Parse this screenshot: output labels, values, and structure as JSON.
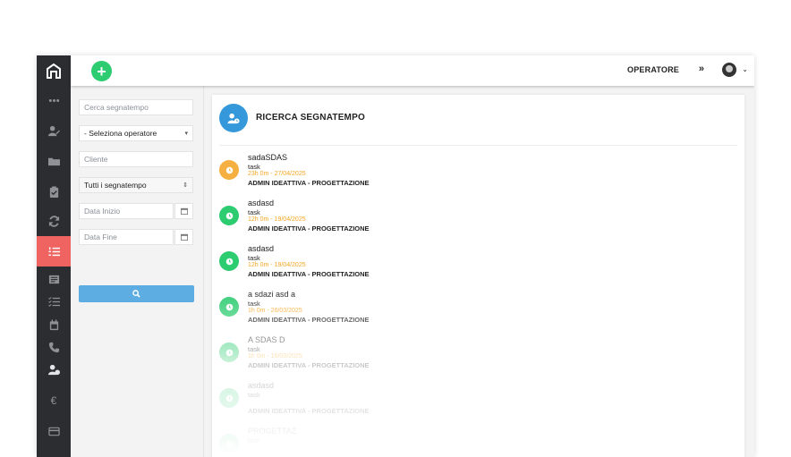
{
  "topbar": {
    "operator_label": "OPERATORE",
    "operator_arrows": "»",
    "avatar_caret": "⌄"
  },
  "filters": {
    "search_placeholder": "Cerca segnatempo",
    "operator_select": "- Seleziona operatore",
    "client_placeholder": "Cliente",
    "type_select": "Tutti i segnatempo",
    "date_start_placeholder": "Data Inizio",
    "date_end_placeholder": "Data Fine"
  },
  "main": {
    "title": "RICERCA SEGNATEMPO",
    "entries": [
      {
        "name": "sadaSDAS",
        "type": "task",
        "time": "23h 0m - 27/04/2025",
        "client": "ADMIN IDEATTIVA - PROGETTAZIONE",
        "color": "#f5b041"
      },
      {
        "name": "asdasd",
        "type": "task",
        "time": "12h 0m - 19/04/2025",
        "client": "ADMIN IDEATTIVA - PROGETTAZIONE",
        "color": "#2ecc71"
      },
      {
        "name": "asdasd",
        "type": "task",
        "time": "12h 0m - 19/04/2025",
        "client": "ADMIN IDEATTIVA - PROGETTAZIONE",
        "color": "#2ecc71"
      },
      {
        "name": "a sdazi asd a",
        "type": "task",
        "time": "1h 0m - 26/03/2025",
        "client": "ADMIN IDEATTIVA - PROGETTAZIONE",
        "color": "#2ecc71"
      },
      {
        "name": "A SDAS D",
        "type": "task",
        "time": "1h 0m - 16/03/2025",
        "client": "ADMIN IDEATTIVA - PROGETTAZIONE",
        "color": "#2ecc71"
      },
      {
        "name": "asdasd",
        "type": "task",
        "time": "",
        "client": "ADMIN IDEATTIVA - PROGETTAZIONE",
        "color": "#2ecc71"
      },
      {
        "name": "PROGETTAZ",
        "type": "task",
        "time": "",
        "client": "",
        "color": "#2ecc71"
      }
    ]
  },
  "colors": {
    "sidebar_bg": "#2b2d30",
    "active_item": "#ef6461",
    "add_button": "#2ecc71",
    "search_button": "#5dade2",
    "title_icon": "#3498db",
    "time_text": "#f5a623"
  },
  "icons": {
    "sidebar": [
      "logo-icon",
      "more-icon",
      "user-edit-icon",
      "folder-icon",
      "clipboard-check-icon",
      "sync-icon",
      "list-ordered-icon",
      "newspaper-icon",
      "tasks-icon",
      "calendar-icon",
      "phone-icon",
      "user-clock-icon",
      "euro-icon",
      "credit-card-icon"
    ]
  }
}
